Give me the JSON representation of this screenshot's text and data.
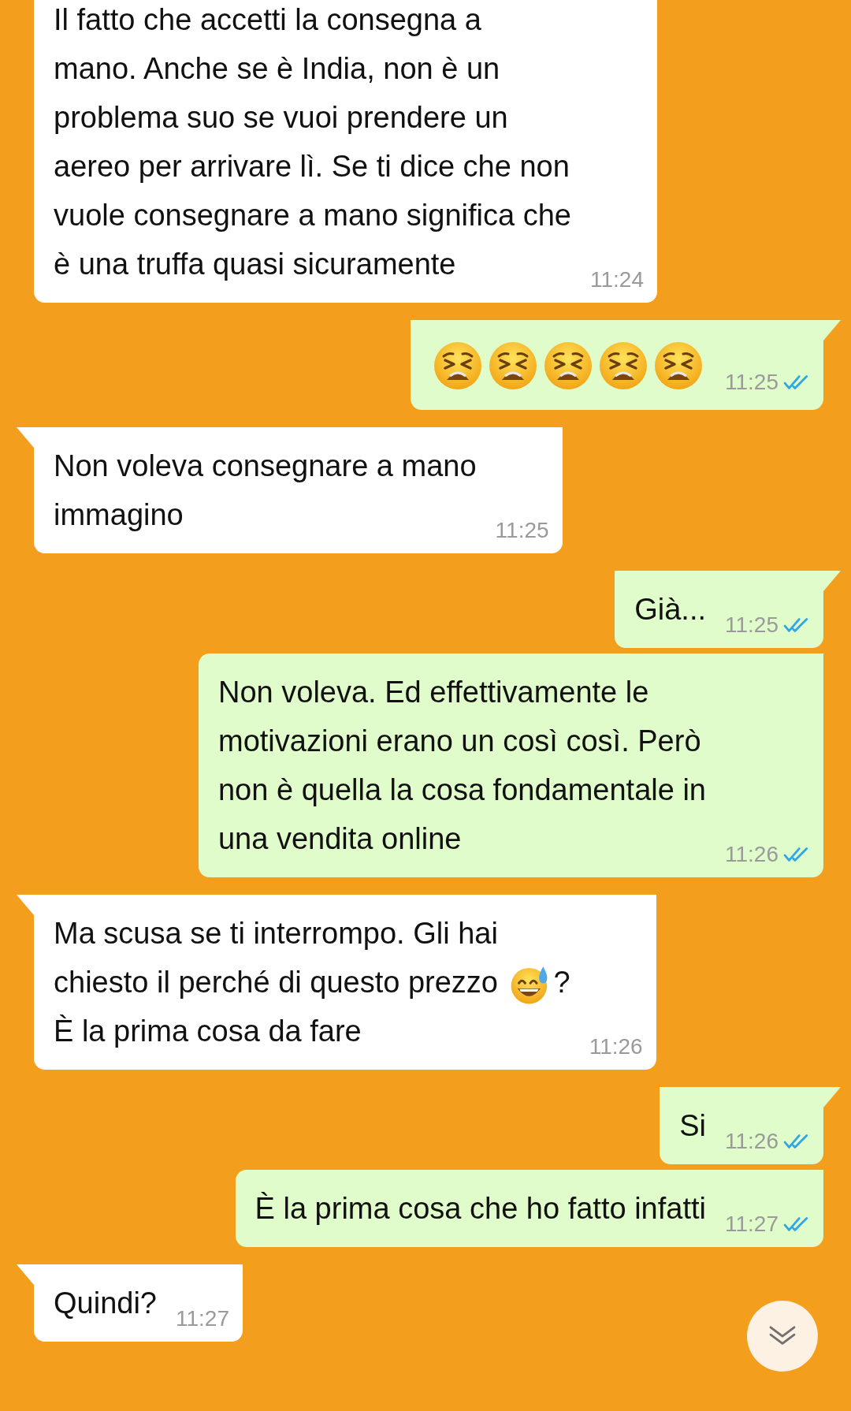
{
  "messages": [
    {
      "kind": "incoming",
      "parts": [
        {
          "kind": "text",
          "text": "Il fatto che accetti la consegna a\nmano. Anche se è India, non è un\nproblema suo se vuoi prendere un\naereo per arrivare lì. Se ti dice che non\nvuole consegnare a mano significa che\nè una truffa quasi sicuramente"
        }
      ],
      "time": "11:24"
    },
    {
      "kind": "outgoing",
      "tail": true,
      "parts": [
        {
          "kind": "emoji-tired"
        },
        {
          "kind": "emoji-tired"
        },
        {
          "kind": "emoji-tired"
        },
        {
          "kind": "emoji-tired"
        },
        {
          "kind": "emoji-tired"
        }
      ],
      "time": "11:25",
      "read": true
    },
    {
      "kind": "incoming",
      "tail": true,
      "parts": [
        {
          "kind": "text",
          "text": "Non voleva consegnare a mano\nimmagino"
        }
      ],
      "time": "11:25"
    },
    {
      "kind": "outgoing",
      "tail": true,
      "parts": [
        {
          "kind": "text",
          "text": "Già..."
        }
      ],
      "time": "11:25",
      "read": true
    },
    {
      "kind": "outgoing",
      "tail": false,
      "parts": [
        {
          "kind": "text",
          "text": "Non voleva. Ed effettivamente le\nmotivazioni erano un così così. Però\nnon è quella la cosa fondamentale in\nuna vendita online"
        }
      ],
      "time": "11:26",
      "read": true
    },
    {
      "kind": "incoming",
      "tail": true,
      "parts": [
        {
          "kind": "text",
          "text": "Ma scusa se ti interrompo. Gli hai\nchiesto il perché di questo prezzo "
        },
        {
          "kind": "emoji-sweat"
        },
        {
          "kind": "text",
          "text": "?"
        },
        {
          "kind": "text",
          "text": "\nÈ la prima cosa da fare"
        }
      ],
      "time": "11:26"
    },
    {
      "kind": "outgoing",
      "tail": true,
      "parts": [
        {
          "kind": "text",
          "text": "Si"
        }
      ],
      "time": "11:26",
      "read": true
    },
    {
      "kind": "outgoing",
      "tail": false,
      "parts": [
        {
          "kind": "text",
          "text": "È la prima cosa che ho fatto infatti"
        }
      ],
      "time": "11:27",
      "read": true
    },
    {
      "kind": "incoming",
      "tail": true,
      "parts": [
        {
          "kind": "text",
          "text": "Quindi?"
        }
      ],
      "time": "11:27"
    }
  ]
}
